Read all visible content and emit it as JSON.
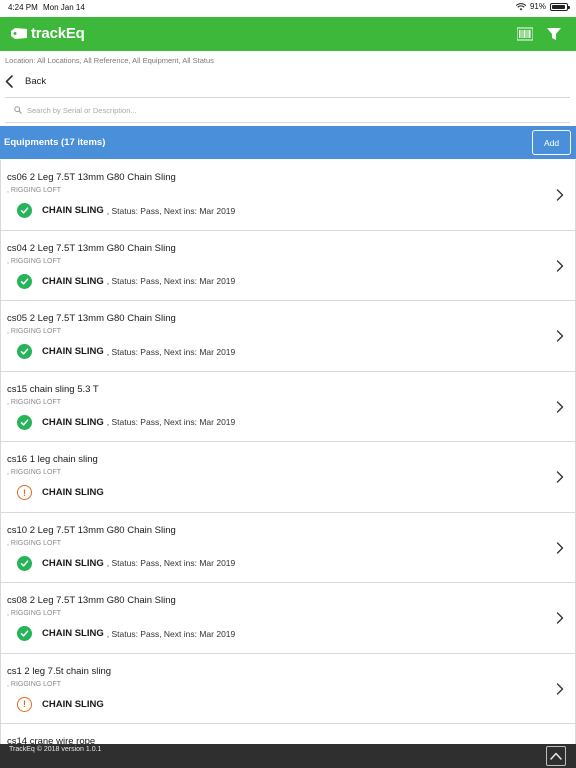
{
  "status_bar": {
    "time": "4:24 PM",
    "date": "Mon Jan 14",
    "battery": "91%",
    "battery_level": 0.91
  },
  "header": {
    "logo_text": "trackEq",
    "colors": {
      "header": "#3db83a",
      "list_header": "#4a8fd9"
    }
  },
  "filter_summary": "Location: All Locations, All Reference, All Equipment, All Status",
  "back_label": "Back",
  "search": {
    "placeholder": "Search by Serial or Description...",
    "value": ""
  },
  "list": {
    "title": "Equipments (17 items)",
    "add_label": "Add",
    "items": [
      {
        "title": "cs06 2 Leg 7.5T 13mm G80 Chain Sling",
        "location": ", RIGGING LOFT",
        "type": "CHAIN SLING",
        "detail": ", Status: Pass, Next ins: Mar 2019",
        "status": "pass"
      },
      {
        "title": "cs04 2 Leg 7.5T 13mm G80 Chain Sling",
        "location": ", RIGGING LOFT",
        "type": "CHAIN SLING",
        "detail": ", Status: Pass, Next ins: Mar 2019",
        "status": "pass"
      },
      {
        "title": "cs05 2 Leg 7.5T 13mm G80 Chain Sling",
        "location": ", RIGGING LOFT",
        "type": "CHAIN SLING",
        "detail": ", Status: Pass, Next ins: Mar 2019",
        "status": "pass"
      },
      {
        "title": "cs15 chain sling 5.3 T",
        "location": ", RIGGING LOFT",
        "type": "CHAIN SLING",
        "detail": ", Status: Pass, Next ins: Mar 2019",
        "status": "pass"
      },
      {
        "title": "cs16 1 leg chain sling",
        "location": ", RIGGING LOFT",
        "type": "CHAIN SLING",
        "detail": "",
        "status": "warning"
      },
      {
        "title": "cs10 2 Leg 7.5T 13mm G80 Chain Sling",
        "location": ", RIGGING LOFT",
        "type": "CHAIN SLING",
        "detail": ", Status: Pass, Next ins: Mar 2019",
        "status": "pass"
      },
      {
        "title": "cs08 2 Leg 7.5T 13mm G80 Chain Sling",
        "location": ", RIGGING LOFT",
        "type": "CHAIN SLING",
        "detail": ", Status: Pass, Next ins: Mar 2019",
        "status": "pass"
      },
      {
        "title": "cs1 2 leg 7.5t chain sling",
        "location": ", RIGGING LOFT",
        "type": "CHAIN SLING",
        "detail": "",
        "status": "warning"
      },
      {
        "title": "cs14 crane wire rope",
        "location": "",
        "type": "",
        "detail": "",
        "status": ""
      }
    ]
  },
  "footer": {
    "text": "TrackEq © 2018 version 1.0.1"
  }
}
